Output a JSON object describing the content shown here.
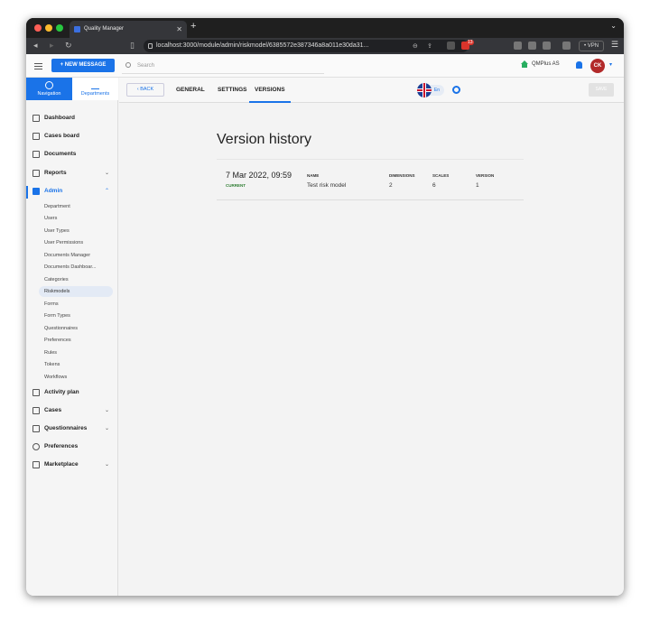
{
  "browser": {
    "tab_title": "Quality Manager",
    "new_tab": "+",
    "url": "localhost:3000/module/admin/riskmodel/6385572e387346a8a011e30da31...",
    "vpn_label": "• VPN",
    "ext_badge": "13"
  },
  "topbar": {
    "new_message": "+ NEW MESSAGE",
    "search_placeholder": "Search",
    "org_name": "QMPlus AS",
    "avatar_initials": "CK"
  },
  "sidebar": {
    "tabs": [
      {
        "label": "Navigation"
      },
      {
        "label": "Departments"
      }
    ],
    "items": [
      {
        "label": "Dashboard"
      },
      {
        "label": "Cases board"
      },
      {
        "label": "Documents"
      },
      {
        "label": "Reports"
      },
      {
        "label": "Admin"
      },
      {
        "label": "Activity plan"
      },
      {
        "label": "Cases"
      },
      {
        "label": "Questionnaires"
      },
      {
        "label": "Preferences"
      },
      {
        "label": "Marketplace"
      }
    ],
    "admin_sub": [
      "Department",
      "Users",
      "User Types",
      "User Permissions",
      "Documents Manager",
      "Documents Dashboar...",
      "Categories",
      "Riskmodels",
      "Forms",
      "Form Types",
      "Questionnaires",
      "Preferences",
      "Rules",
      "Tokens",
      "Workflows"
    ]
  },
  "subnav": {
    "back": "BACK",
    "tabs": [
      "GENERAL",
      "SETTINGS",
      "VERSIONS"
    ],
    "lang": "En",
    "save": "SAVE"
  },
  "page": {
    "title": "Version history",
    "version": {
      "date": "7 Mar 2022, 09:59",
      "status": "CURRENT",
      "name_header": "NAME",
      "name": "Test risk model",
      "dimensions_header": "DIMENSIONS",
      "dimensions": "2",
      "scales_header": "SCALES",
      "scales": "6",
      "version_header": "VERSION",
      "version": "1"
    }
  }
}
